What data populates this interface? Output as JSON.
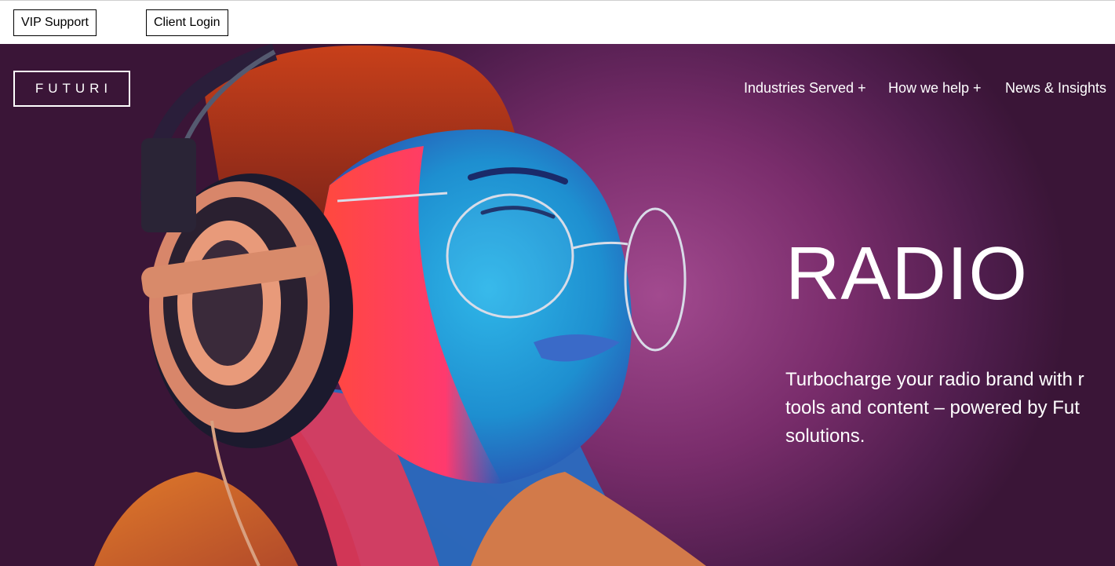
{
  "topbar": {
    "vip_support": "VIP Support",
    "client_login": "Client Login"
  },
  "logo": {
    "text": "FUTURI"
  },
  "nav": {
    "items": [
      {
        "label": "Industries Served +"
      },
      {
        "label": "How we help +"
      },
      {
        "label": "News & Insights"
      }
    ]
  },
  "hero": {
    "title": "RADIO",
    "subtitle_lines": [
      "Turbocharge your radio brand with r",
      "tools and content – powered by Fut",
      "solutions."
    ],
    "image": "woman-with-headphones-and-glasses",
    "colors": {
      "background": "#7a2d6c",
      "text": "#ffffff"
    }
  }
}
